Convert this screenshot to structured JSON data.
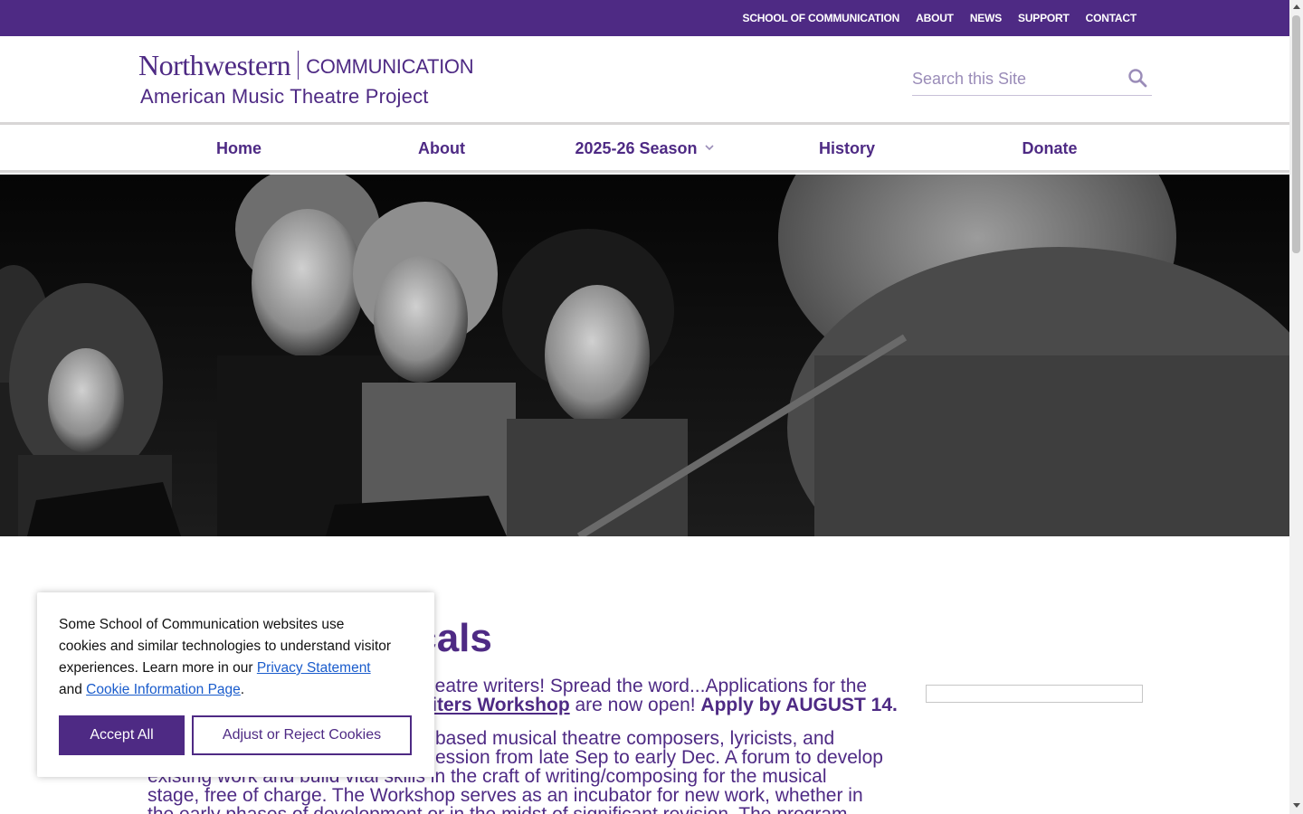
{
  "colors": {
    "brand": "#4e2a84",
    "link": "#1a5ccc"
  },
  "topbar": {
    "links": [
      "SCHOOL OF COMMUNICATION",
      "ABOUT",
      "NEWS",
      "SUPPORT",
      "CONTACT"
    ]
  },
  "header": {
    "logo_northwestern": "Northwestern",
    "logo_communication": "COMMUNICATION",
    "site_name": "American Music Theatre Project",
    "search_placeholder": "Search this Site"
  },
  "nav": {
    "items": [
      "Home",
      "About",
      "2025-26 Season",
      "History",
      "Donate"
    ]
  },
  "main": {
    "title_visible": "icals",
    "intro_line1": "heatre writers! Spread the word...Applications for the",
    "intro_link": "riters Workshop",
    "intro_mid": " are now open! ",
    "intro_bold": "Apply by AUGUST 14.",
    "body_line1": "based musical theatre composers, lyricists, and",
    "body_line2": "ession from late Sep to early Dec. A forum to develop",
    "body_line3": "existing work and build vital skills in the craft of writing/composing for the musical",
    "body_line4": "stage, free of charge. The Workshop serves as an incubator for new work, whether in",
    "body_line5": "the early phases of development or in the midst of significant revision. The program"
  },
  "cookie": {
    "text_before": "Some School of Communication websites use cookies and similar technologies to understand visitor experiences. Learn more in our ",
    "privacy_link": "Privacy Statement",
    "text_and": " and ",
    "cookie_link": "Cookie Information Page",
    "text_end": ".",
    "accept_label": "Accept All",
    "adjust_label": "Adjust or Reject Cookies"
  }
}
